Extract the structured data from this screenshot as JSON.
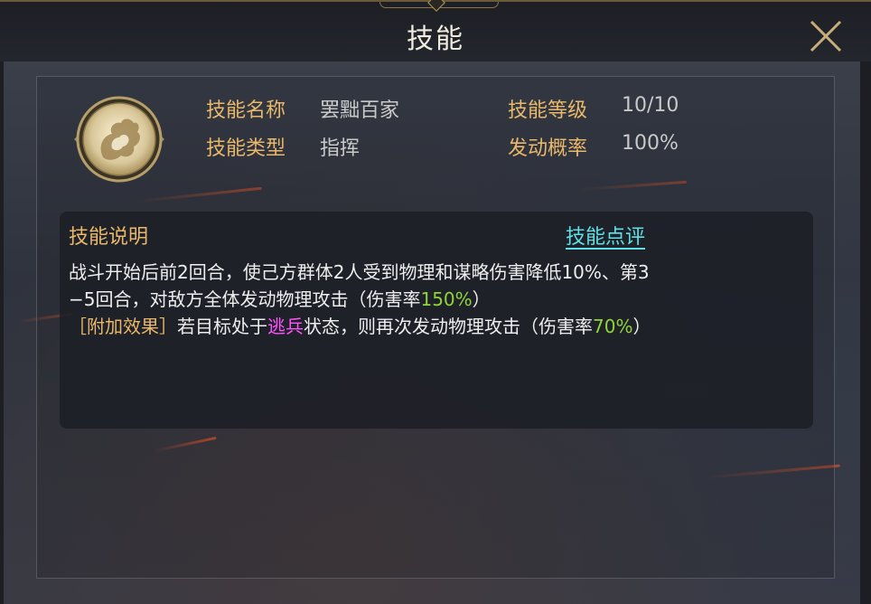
{
  "header": {
    "title": "技能"
  },
  "skill": {
    "name_label": "技能名称",
    "name_value": "罢黜百家",
    "type_label": "技能类型",
    "type_value": "指挥",
    "level_label": "技能等级",
    "level_value": "10/10",
    "rate_label": "发动概率",
    "rate_value": "100%",
    "icon": "flame-spirit-icon"
  },
  "description": {
    "title": "技能说明",
    "review_link": "技能点评",
    "line1": "战斗开始后前2回合，使己方群体2人受到物理和谋略伤害降低10%、第3",
    "line2_prefix": "−5回合，对敌方全体发动物理攻击（伤害率",
    "line2_value": "150%",
    "line2_suffix": "）",
    "extra_tag": "［附加效果］",
    "line3_prefix": "若目标处于",
    "line3_status": "逃兵",
    "line3_mid": "状态，则再次发动物理攻击（伤害率",
    "line3_value": "70%",
    "line3_suffix": "）"
  },
  "colors": {
    "label_gold": "#e9b86a",
    "highlight_green": "#8fd43a",
    "status_magenta": "#ff55ff",
    "link_cyan": "#5fe0e6"
  }
}
